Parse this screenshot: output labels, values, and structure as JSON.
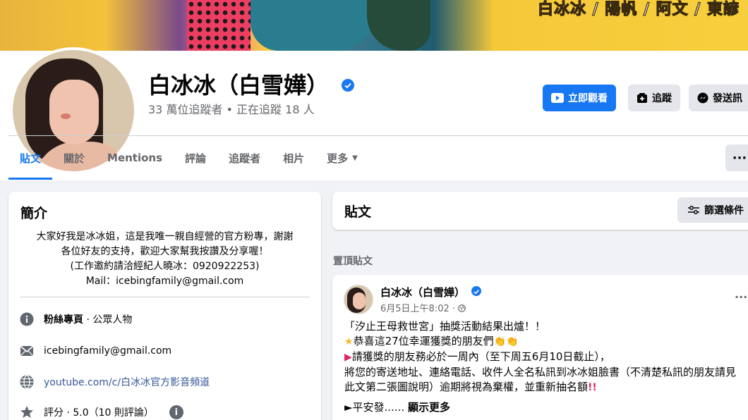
{
  "cover": {
    "cast_text": "白冰冰 / 陽帆 / 阿文 / 東諺"
  },
  "profile": {
    "name": "白冰冰（白雪嬅）",
    "stats": "33 萬位追蹤者 • 正在追蹤 18 人"
  },
  "actions": {
    "watch_label": "立即觀看",
    "follow_label": "追蹤",
    "message_label": "發送訊"
  },
  "tabs": [
    {
      "label": "貼文"
    },
    {
      "label": "關於"
    },
    {
      "label": "Mentions"
    },
    {
      "label": "評論"
    },
    {
      "label": "追蹤者"
    },
    {
      "label": "相片"
    },
    {
      "label": "更多"
    }
  ],
  "more_dots": "···",
  "intro": {
    "title": "簡介",
    "bio": [
      "大家好我是冰冰姐，這是我唯一親自經營的官方粉專，謝謝",
      "各位好友的支持，歡迎大家幫我按讚及分享喔！",
      "(工作邀約請洽經紀人曉冰：0920922253)",
      "Mail：icebingfamily@gmail.com"
    ],
    "page_type_bold": "粉絲專頁",
    "page_type_rest": " · 公眾人物",
    "email": "icebingfamily@gmail.com",
    "youtube": "youtube.com/c/白冰冰官方影音頻道",
    "rating": "評分 · 5.0（10 則評論）",
    "rating_info": "i",
    "icons": [
      "info-icon",
      "mail-icon",
      "globe-icon",
      "star-icon"
    ]
  },
  "posts": {
    "title": "貼文",
    "filter_label": "篩選條件",
    "pinned_label": "置頂貼文",
    "post": {
      "author": "白冰冰（白雪嬅）",
      "time": "6月5日上午8:02 · ",
      "lines": [
        "「汐止王母救世宮」抽獎活動結果出爐！！",
        "恭喜這27位幸運獲獎的朋友們",
        "請獲獎的朋友務必於一周內（至下周五6月10日截止），",
        "將您的寄送地址、連絡電話、收件人全名私訊到冰冰姐臉書（不清楚私訊的朋友請見",
        "此文第二張圖說明）逾期將視為棄權，並重新抽名額"
      ],
      "more_prefix": "►平安發......",
      "more_link": "顯示更多"
    }
  },
  "colors": {
    "accent": "#1877f2",
    "background": "#f0f2f5",
    "secondary_text": "#65676b"
  }
}
